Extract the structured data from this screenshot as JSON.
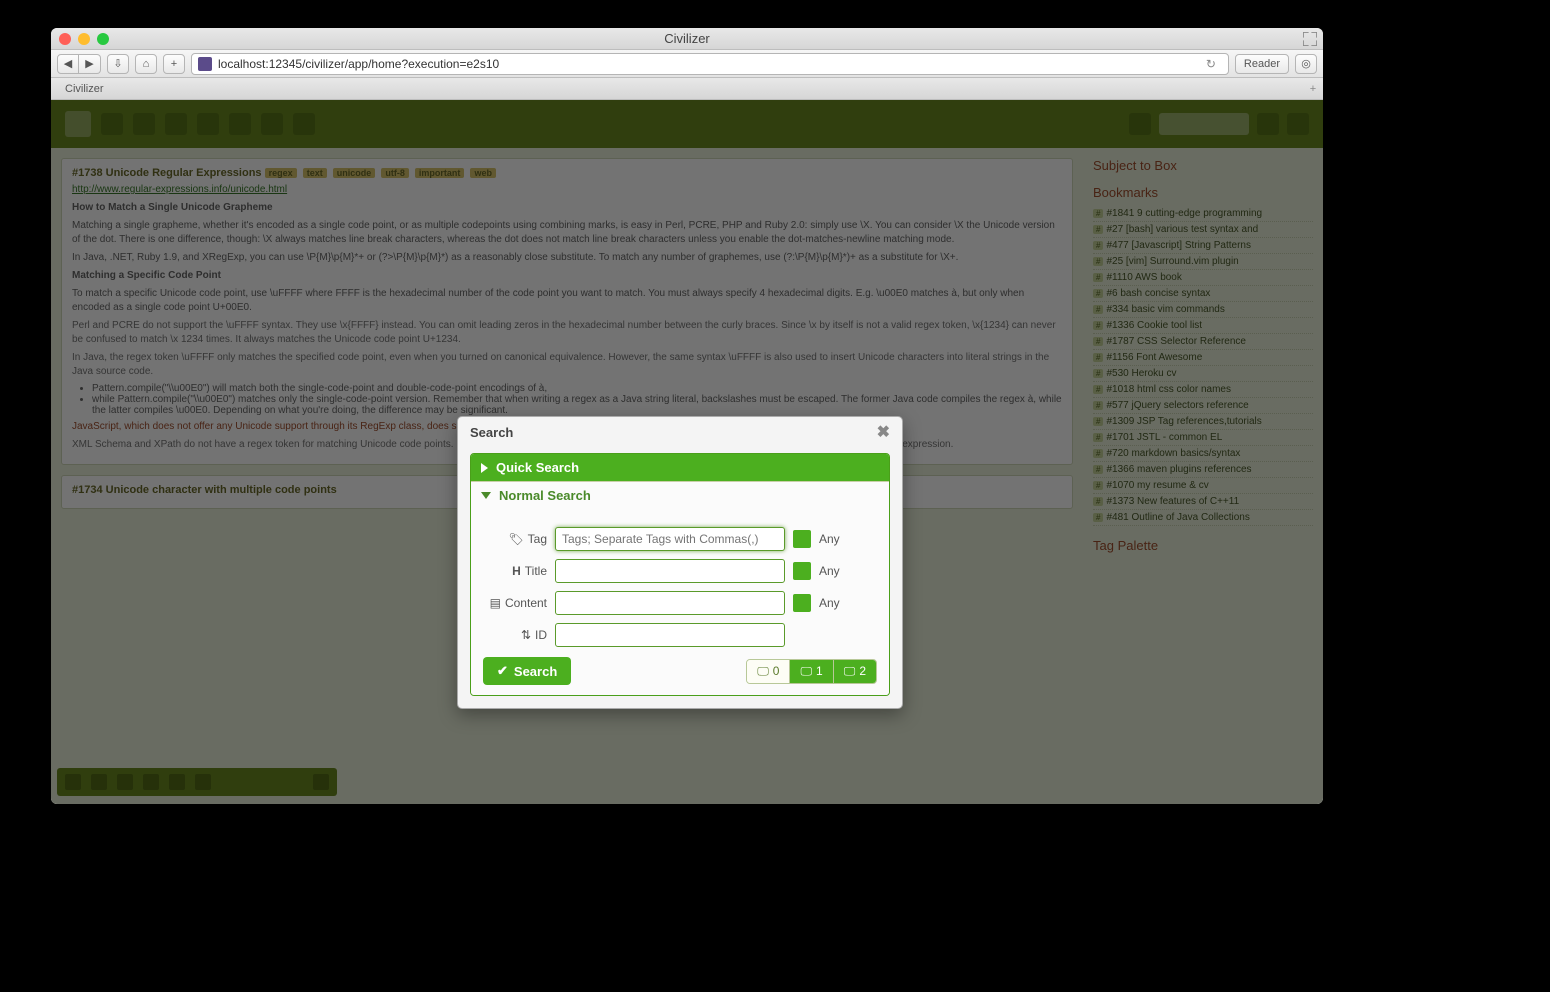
{
  "window_title": "Civilizer",
  "url": "localhost:12345/civilizer/app/home?execution=e2s10",
  "reader_label": "Reader",
  "tab_title": "Civilizer",
  "dialog": {
    "title": "Search",
    "quick_search_label": "Quick Search",
    "normal_search_label": "Normal Search",
    "fields": {
      "tag_label": "Tag",
      "tag_placeholder": "Tags; Separate Tags with Commas(,)",
      "title_label": "Title",
      "content_label": "Content",
      "id_label": "ID",
      "any_label": "Any"
    },
    "search_button": "Search",
    "panel_options": [
      "0",
      "1",
      "2"
    ]
  },
  "background": {
    "card1_id": "#1738",
    "card1_title": "Unicode Regular Expressions",
    "card1_tags": [
      "regex",
      "text",
      "unicode",
      "utf-8",
      "important",
      "web"
    ],
    "card1_link": "http://www.regular-expressions.info/unicode.html",
    "card1_h1": "How to Match a Single Unicode Grapheme",
    "card1_p1": "Matching a single grapheme, whether it's encoded as a single code point, or as multiple codepoints using combining marks, is easy in Perl, PCRE, PHP and Ruby 2.0: simply use \\X. You can consider \\X the Unicode version of the dot. There is one difference, though: \\X always matches line break characters, whereas the dot does not match line break characters unless you enable the dot-matches-newline matching mode.",
    "card1_p2": "In Java, .NET, Ruby 1.9, and XRegExp, you can use \\P{M}\\p{M}*+ or (?>\\P{M}\\p{M}*) as a reasonably close substitute. To match any number of graphemes, use (?:\\P{M}\\p{M}*)+ as a substitute for \\X+.",
    "card1_h2": "Matching a Specific Code Point",
    "card1_p3": "To match a specific Unicode code point, use \\uFFFF where FFFF is the hexadecimal number of the code point you want to match. You must always specify 4 hexadecimal digits. E.g. \\u00E0 matches à, but only when encoded as a single code point U+00E0.",
    "card2_id": "#1734",
    "card2_title": "Unicode character with multiple code points",
    "right_section1": "Subject to Box",
    "right_section2_title": "Bookmarks",
    "right_items": [
      "#1841 9 cutting-edge programming",
      "#27 [bash] various test syntax and",
      "#477 [Javascript] String Patterns",
      "#25 [vim] Surround.vim plugin",
      "#1110 AWS book",
      "#6 bash concise syntax",
      "#334 basic vim commands",
      "#1336 Cookie tool list",
      "#1787 CSS Selector Reference",
      "#1156 Font Awesome",
      "#530 Heroku cv",
      "#1018 html css color names",
      "#577 jQuery selectors reference",
      "#1309 JSP Tag references,tutorials",
      "#1701 JSTL - common EL",
      "#720 markdown basics/syntax",
      "#1366 maven plugins references",
      "#1070 my resume & cv",
      "#1373 New features of C++11",
      "#481 Outline of Java Collections"
    ],
    "right_section3": "Tag Palette"
  }
}
